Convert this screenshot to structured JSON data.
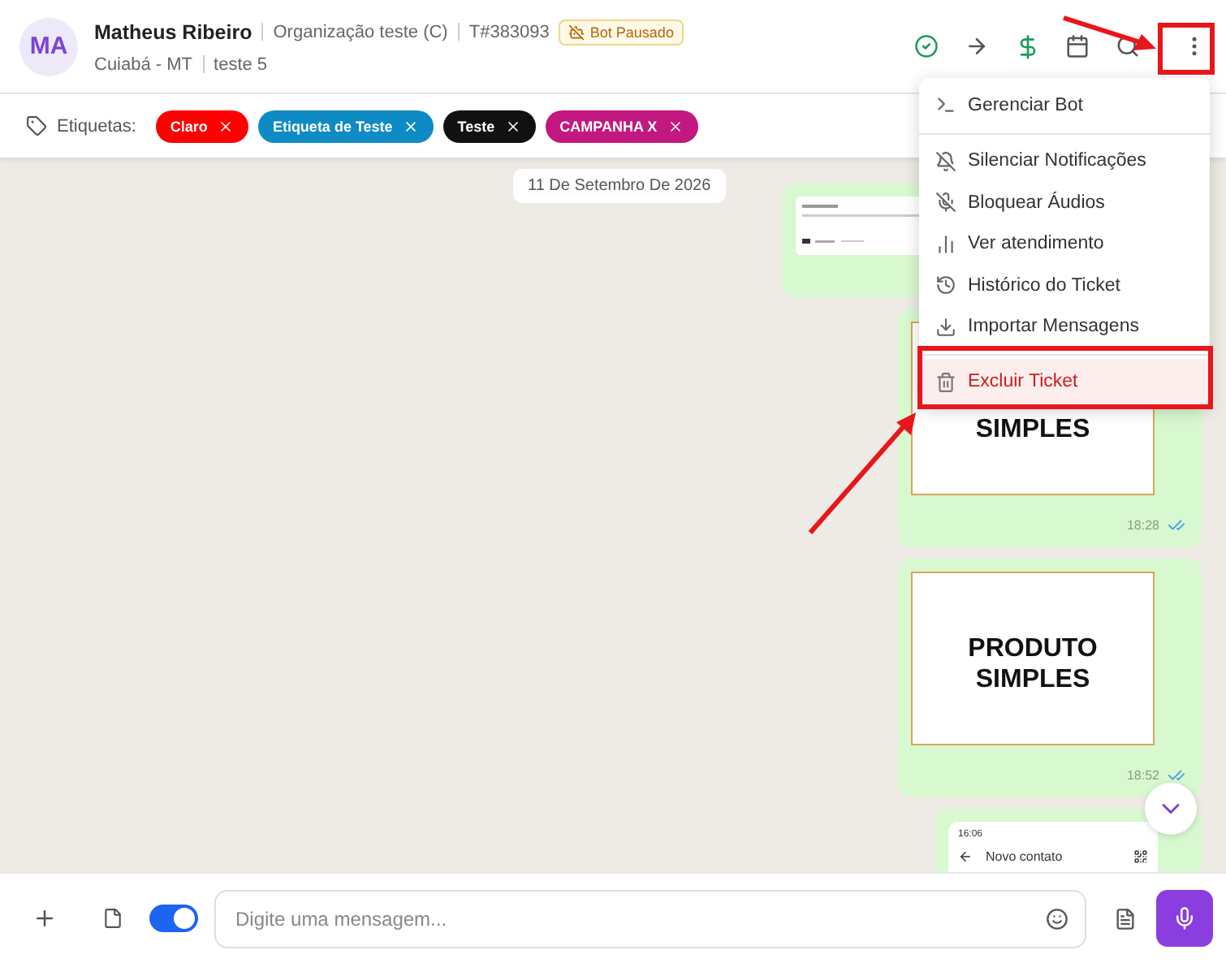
{
  "contact": {
    "initials": "MA",
    "name": "Matheus Ribeiro",
    "organization": "Organização teste (C)",
    "ticket": "T#383093",
    "bot_status": "Bot Pausado",
    "location": "Cuiabá - MT",
    "queue": "teste 5"
  },
  "tags_label": "Etiquetas:",
  "tags": [
    {
      "label": "Claro",
      "color": "#ff0000"
    },
    {
      "label": "Etiqueta de Teste",
      "color": "#0e8bc4"
    },
    {
      "label": "Teste",
      "color": "#111111"
    },
    {
      "label": "CAMPANHA X",
      "color": "#c2187f"
    }
  ],
  "date_chip": "11 De Setembro De 2026",
  "messages": [
    {
      "kind": "document"
    },
    {
      "kind": "image",
      "image_text": [
        "SIMPLES"
      ],
      "time": "18:28",
      "read": true
    },
    {
      "kind": "image",
      "image_text": [
        "PRODUTO",
        "SIMPLES"
      ],
      "time": "18:52",
      "read": true
    },
    {
      "kind": "screenshot",
      "status_time": "16:06",
      "screen_title": "Novo contato"
    }
  ],
  "menu": {
    "groups": [
      [
        {
          "label": "Gerenciar Bot",
          "kind": "normal"
        }
      ],
      [
        {
          "label": "Silenciar Notificações",
          "kind": "normal"
        },
        {
          "label": "Bloquear Áudios",
          "kind": "normal"
        },
        {
          "label": "Ver atendimento",
          "kind": "normal"
        },
        {
          "label": "Histórico do Ticket",
          "kind": "normal"
        },
        {
          "label": "Importar Mensagens",
          "kind": "normal"
        }
      ],
      [
        {
          "label": "Excluir Ticket",
          "kind": "danger"
        }
      ]
    ]
  },
  "composer": {
    "placeholder": "Digite uma mensagem...",
    "signature_on": true
  }
}
